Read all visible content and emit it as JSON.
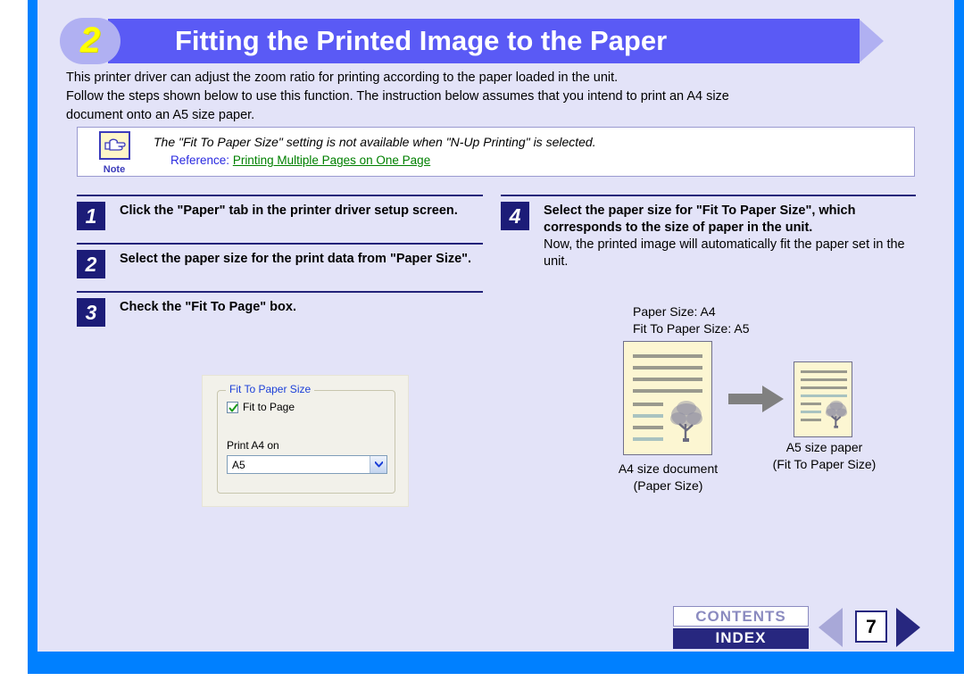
{
  "header": {
    "number": "2",
    "title": "Fitting the Printed Image to the Paper"
  },
  "intro": {
    "line1": "This printer driver can adjust the zoom ratio for printing according to the paper loaded in the unit.",
    "line2": "Follow the steps shown below to use this function. The instruction below assumes that you intend to print an A4 size",
    "line3": "document onto an A5 size paper."
  },
  "note": {
    "icon_label": "Note",
    "text": "The \"Fit To Paper Size\" setting is not available when \"N-Up Printing\" is selected.",
    "reference_label": "Reference:",
    "reference_link": "Printing Multiple Pages on One Page"
  },
  "steps_left": [
    {
      "number": "1",
      "text": "Click the \"Paper\" tab in the printer driver setup screen."
    },
    {
      "number": "2",
      "text": "Select the paper size for the print data from \"Paper Size\"."
    },
    {
      "number": "3",
      "text": "Check the \"Fit To Page\" box."
    }
  ],
  "steps_right": [
    {
      "number": "4",
      "text": "Select the paper size for \"Fit To Paper Size\", which corresponds to the size of paper in the unit.",
      "subtext": "Now, the printed image will automatically fit the paper set in the unit."
    }
  ],
  "dialog": {
    "group_title": "Fit To Paper Size",
    "checkbox_label": "Fit to Page",
    "checkbox_checked": "true",
    "field_label": "Print A4 on",
    "combo_value": "A5"
  },
  "illustration": {
    "caption_top_line1": "Paper Size: A4",
    "caption_top_line2": "Fit To Paper Size: A5",
    "left_caption_line1": "A4 size document",
    "left_caption_line2": "(Paper Size)",
    "right_caption_line1": "A5 size paper",
    "right_caption_line2": "(Fit To Paper Size)"
  },
  "footer": {
    "contents_label": "CONTENTS",
    "index_label": "INDEX",
    "page_number": "7"
  },
  "colors": {
    "frame_blue": "#0080ff",
    "page_bg": "#e3e3f8",
    "header_bar": "#5a5af5",
    "header_accent": "#b0b0f2",
    "header_number": "#ffff00",
    "step_navy": "#1c1c78",
    "link_green": "#008000",
    "ref_blue": "#2a2ae0",
    "doc_yellow": "#fcf6d2",
    "arrow_gray": "#808080"
  }
}
